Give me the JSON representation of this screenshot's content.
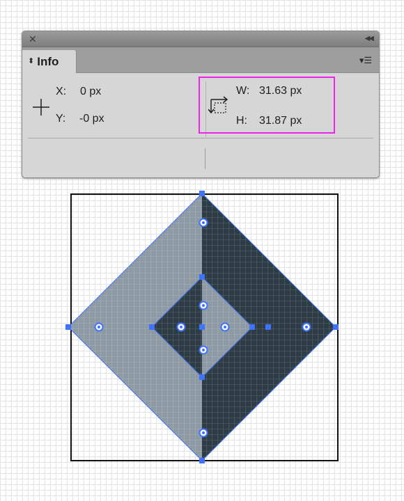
{
  "panel": {
    "close_icon": "close-icon",
    "collapse_icon": "collapse-arrows-icon",
    "tab_label": "Info",
    "tab_icon": "updown-arrows-icon",
    "menu_icon": "panel-menu-icon",
    "x_label": "X:",
    "x_value": "0 px",
    "y_label": "Y:",
    "y_value": "-0 px",
    "w_label": "W:",
    "w_value": "31.63 px",
    "h_label": "H:",
    "h_value": "31.87 px",
    "highlight_color": "#ee22ee"
  },
  "artwork": {
    "light_color": "#8d9aa3",
    "dark_color": "#2e3d45",
    "selection_color": "#3f73ff"
  }
}
